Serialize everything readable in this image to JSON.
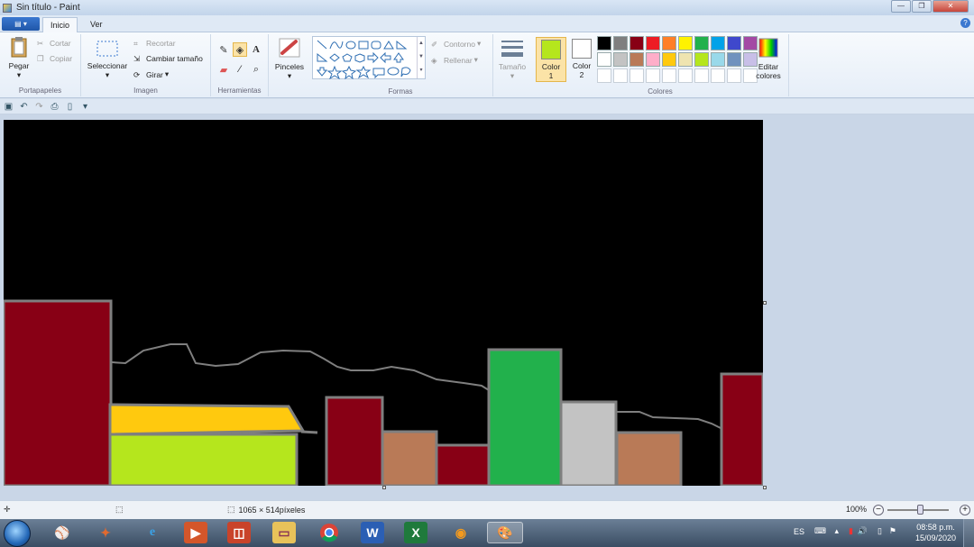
{
  "window": {
    "title": "Sin título - Paint"
  },
  "tabs": [
    {
      "label": "Inicio",
      "active": true
    },
    {
      "label": "Ver",
      "active": false
    }
  ],
  "clipboard": {
    "paste": "Pegar",
    "cut": "Cortar",
    "copy": "Copiar",
    "group": "Portapapeles"
  },
  "image": {
    "select": "Seleccionar",
    "crop": "Recortar",
    "resize": "Cambiar tamaño",
    "rotate": "Girar",
    "group": "Imagen"
  },
  "tools": {
    "group": "Herramientas",
    "items": [
      "pencil-icon",
      "fill-icon",
      "text-icon",
      "eraser-icon",
      "color-picker-icon",
      "magnifier-icon"
    ]
  },
  "brushes": {
    "label": "Pinceles"
  },
  "shapes": {
    "outline": "Contorno",
    "fill": "Rellenar",
    "group": "Formas"
  },
  "size": {
    "label": "Tamaño"
  },
  "colors": {
    "color1_label": "Color",
    "color1_num": "1",
    "color1_value": "#b5e61d",
    "color2_label": "Color",
    "color2_num": "2",
    "color2_value": "#ffffff",
    "edit_line1": "Editar",
    "edit_line2": "colores",
    "group": "Colores",
    "palette": [
      "#000000",
      "#7f7f7f",
      "#880015",
      "#ed1c24",
      "#ff7f27",
      "#fff200",
      "#22b14c",
      "#00a2e8",
      "#3f48cc",
      "#a349a4",
      "#ffffff",
      "#c3c3c3",
      "#b97a57",
      "#ffaec9",
      "#ffc90e",
      "#efe4b0",
      "#b5e61d",
      "#99d9ea",
      "#7092be",
      "#c8bfe7"
    ]
  },
  "status": {
    "dimensions": "1065 × 514píxeles",
    "zoom": "100%"
  },
  "taskbar": {
    "language": "ES",
    "time": "08:58 p.m.",
    "date": "15/09/2020"
  },
  "painting": {
    "sky": "#000000",
    "outline": "#7f7f7f",
    "buildings": [
      "#880015",
      "#b5e61d",
      "#ffc90e",
      "#880015",
      "#b97a57",
      "#880015",
      "#22b14c",
      "#c3c3c3",
      "#b97a57",
      "#880015"
    ]
  }
}
